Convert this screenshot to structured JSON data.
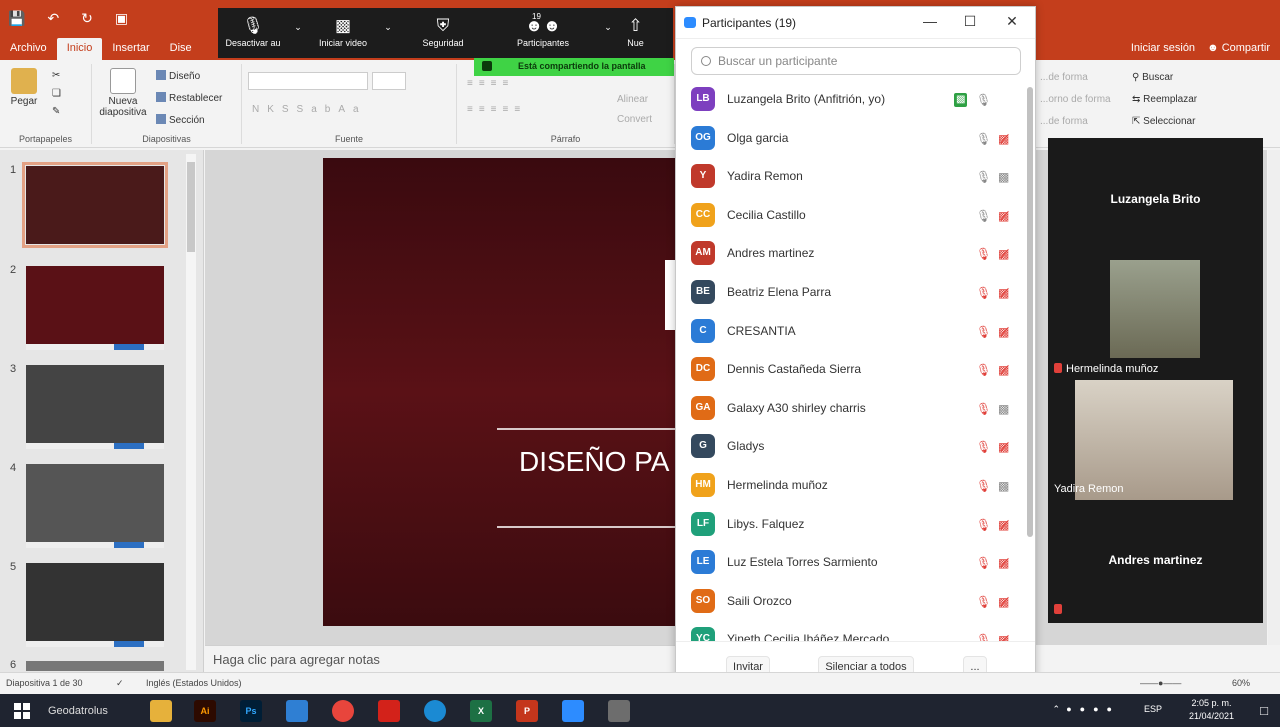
{
  "powerpoint": {
    "tabs": [
      "Archivo",
      "Inicio",
      "Insertar",
      "Dise"
    ],
    "active_tab": "Inicio",
    "right_links": [
      "Iniciar sesión",
      "Compartir"
    ],
    "clipboard": {
      "paste": "Pegar",
      "group": "Portapapeles"
    },
    "slides": {
      "new": "Nueva diapositiva",
      "layout": "Diseño",
      "reset": "Restablecer",
      "section": "Sección",
      "group": "Diapositivas"
    },
    "font_group": "Fuente",
    "paragraph_group": "Párrafo",
    "paragraph_extras": [
      "Alinear",
      "Convert"
    ],
    "editing": {
      "find": "Buscar",
      "replace": "Reemplazar",
      "select": "Seleccionar",
      "shape1": "...de forma",
      "shape2": "...orno de forma",
      "shape3": "...de forma"
    },
    "thumb_numbers": [
      "1",
      "2",
      "3",
      "4",
      "5",
      "6"
    ],
    "slide_title": "DISEÑO PA",
    "notes_placeholder": "Haga clic para agregar notas",
    "status": {
      "slide_count": "Diapositiva 1 de 30",
      "language": "Inglés (Estados Unidos)",
      "zoom": "60%"
    }
  },
  "zoom_toolbar": {
    "buttons": [
      {
        "label": "Desactivar au",
        "icon": "microphone-icon"
      },
      {
        "label": "Iniciar video",
        "icon": "video-off-icon"
      },
      {
        "label": "Seguridad",
        "icon": "shield-icon"
      },
      {
        "label": "Participantes",
        "icon": "participants-icon",
        "count": "19"
      },
      {
        "label": "Nue",
        "icon": "new-share-icon"
      }
    ],
    "share_banner": "Está compartiendo la pantalla"
  },
  "participants_panel": {
    "title": "Participantes (19)",
    "search_placeholder": "Buscar un participante",
    "participants": [
      {
        "initials": "LB",
        "name": "Luzangela Brito (Anfitrión, yo)",
        "color": "#7d3fbf",
        "mic": "on",
        "cam": "live"
      },
      {
        "initials": "OG",
        "name": "Olga garcia",
        "color": "#2b7bd6",
        "mic": "on",
        "cam": "off"
      },
      {
        "initials": "Y",
        "name": "Yadira Remon",
        "color": "#c0392b",
        "mic": "on",
        "cam": "on"
      },
      {
        "initials": "CC",
        "name": "Cecilia Castillo",
        "color": "#f0a21b",
        "mic": "on",
        "cam": "off"
      },
      {
        "initials": "AM",
        "name": "Andres martinez",
        "color": "#c0392b",
        "mic": "off",
        "cam": "off"
      },
      {
        "initials": "BE",
        "name": "Beatriz Elena Parra",
        "color": "#34495e",
        "mic": "off",
        "cam": "off"
      },
      {
        "initials": "C",
        "name": "CRESANTIA",
        "color": "#2b7bd6",
        "mic": "off",
        "cam": "off"
      },
      {
        "initials": "DC",
        "name": "Dennis Castañeda Sierra",
        "color": "#e06b16",
        "mic": "off",
        "cam": "off"
      },
      {
        "initials": "GA",
        "name": "Galaxy A30 shirley charris",
        "color": "#e06b16",
        "mic": "off",
        "cam": "on"
      },
      {
        "initials": "G",
        "name": "Gladys",
        "color": "#34495e",
        "mic": "off",
        "cam": "off"
      },
      {
        "initials": "HM",
        "name": "Hermelinda muñoz",
        "color": "#f0a21b",
        "mic": "off",
        "cam": "on"
      },
      {
        "initials": "LF",
        "name": "Libys. Falquez",
        "color": "#1fa07a",
        "mic": "off",
        "cam": "off"
      },
      {
        "initials": "LE",
        "name": "Luz Estela Torres Sarmiento",
        "color": "#2b7bd6",
        "mic": "off",
        "cam": "off"
      },
      {
        "initials": "SO",
        "name": "Saili Orozco",
        "color": "#e06b16",
        "mic": "off",
        "cam": "off"
      },
      {
        "initials": "YC",
        "name": "Yineth Cecilia Ibáñez Mercado",
        "color": "#1fa07a",
        "mic": "off",
        "cam": "off"
      }
    ],
    "footer": {
      "invite": "Invitar",
      "mute_all": "Silenciar a todos",
      "more": "..."
    }
  },
  "gallery": {
    "tiles": [
      {
        "name": "Luzangela Brito",
        "type": "name"
      },
      {
        "name": "Hermelinda muñoz",
        "type": "video"
      },
      {
        "name": "Yadira Remon",
        "type": "video"
      },
      {
        "name": "Andres martinez",
        "type": "name"
      }
    ]
  },
  "taskbar": {
    "search_text": "Geodatrolus",
    "apps": [
      "files",
      "Ai",
      "Ps",
      "mail",
      "chrome",
      "acrobat",
      "edge",
      "X",
      "P",
      "zoom",
      "misc"
    ],
    "language": "ESP",
    "time": "2:05 p. m.",
    "date": "21/04/2021"
  }
}
